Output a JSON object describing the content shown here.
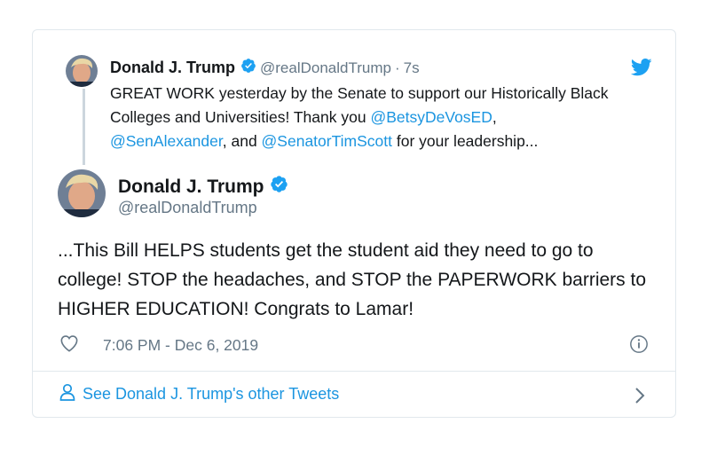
{
  "parent_tweet": {
    "author_name": "Donald J. Trump",
    "handle": "@realDonaldTrump",
    "separator": "·",
    "relative_time": "7s",
    "text_part1": "GREAT WORK yesterday by the Senate to support our Historically Black Colleges and Universities! Thank you ",
    "mention1": "@BetsyDeVosED",
    "text_part2": ", ",
    "mention2": "@SenAlexander",
    "text_part3": ", and ",
    "mention3": "@SenatorTimScott",
    "text_part4": " for your leadership...",
    "avatar_icon": "profile-photo",
    "verified_icon": "verified-badge-icon"
  },
  "main_tweet": {
    "author_name": "Donald J. Trump",
    "handle": "@realDonaldTrump",
    "text": "...This Bill HELPS students get the student aid they need to go to college! STOP the headaches, and STOP the PAPERWORK barriers to HIGHER EDUCATION! Congrats to Lamar!",
    "timestamp": "7:06 PM - Dec 6, 2019"
  },
  "footer": {
    "link_label": "See Donald J. Trump's other Tweets"
  },
  "icons": {
    "bird": "twitter-bird-icon",
    "heart": "heart-icon",
    "info": "info-icon",
    "person": "person-icon",
    "chevron": "chevron-right-icon"
  },
  "colors": {
    "accent": "#1b95e0",
    "verified": "#1da1f2",
    "secondary_text": "#657786",
    "border": "#e1e8ed"
  }
}
